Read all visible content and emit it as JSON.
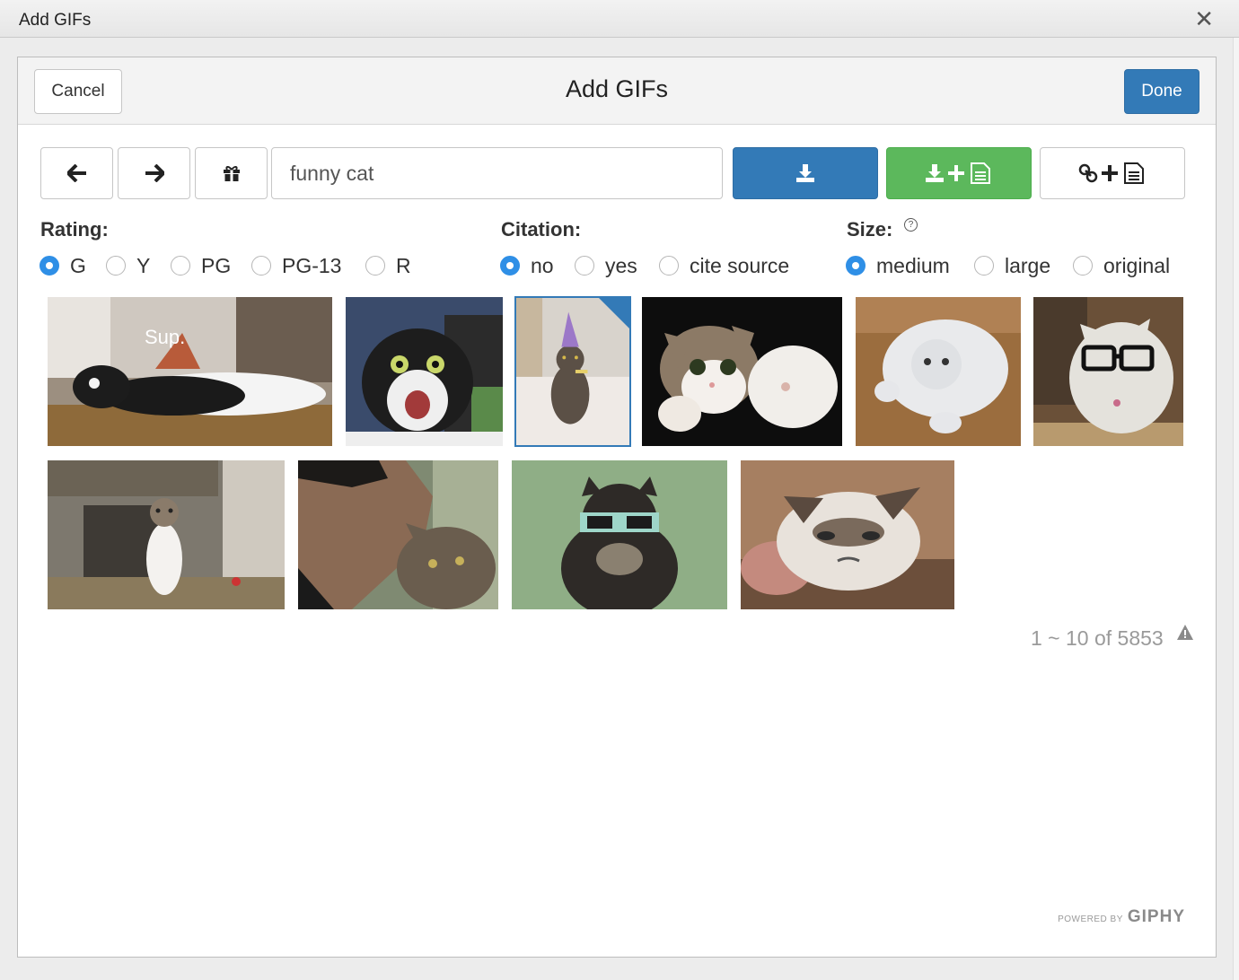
{
  "window": {
    "title": "Add GIFs",
    "close_glyph": "✕"
  },
  "header": {
    "cancel_label": "Cancel",
    "title": "Add GIFs",
    "done_label": "Done"
  },
  "toolbar": {
    "back_icon": "arrow-left-icon",
    "forward_icon": "arrow-right-icon",
    "gift_icon": "gift-icon",
    "search_value": "funny cat",
    "insert_icon": "download-icon",
    "insert_attach_icon": "download-plus-file-icon",
    "link_attach_icon": "link-plus-file-icon"
  },
  "filters": {
    "rating": {
      "label": "Rating:",
      "options": [
        "G",
        "Y",
        "PG",
        "PG-13",
        "R"
      ],
      "selected": "G"
    },
    "citation": {
      "label": "Citation:",
      "options": [
        "no",
        "yes",
        "cite source"
      ],
      "selected": "no"
    },
    "size": {
      "label": "Size:",
      "help": "?",
      "options": [
        "medium",
        "large",
        "original"
      ],
      "selected": "medium"
    }
  },
  "results": {
    "pager_text": "1 ~ 10 of 5853",
    "selected_index": 2,
    "gifs": [
      {
        "caption": "Sup.",
        "subject": "black-white cat lying on floor"
      },
      {
        "subject": "screaming tuxedo cat"
      },
      {
        "subject": "cat with party hat"
      },
      {
        "subject": "kitten with raised paw"
      },
      {
        "subject": "white cat rolling"
      },
      {
        "subject": "cat wearing glasses"
      },
      {
        "subject": "cat standing on hind legs"
      },
      {
        "subject": "woman kissing tabby cat"
      },
      {
        "subject": "cat with pixel sunglasses"
      },
      {
        "subject": "grumpy cat"
      }
    ]
  },
  "footer": {
    "powered_by": "POWERED BY",
    "brand": "GIPHY"
  },
  "colors": {
    "primary": "#337ab7",
    "success": "#5cb85c",
    "radio_on": "#2f8fe6"
  }
}
